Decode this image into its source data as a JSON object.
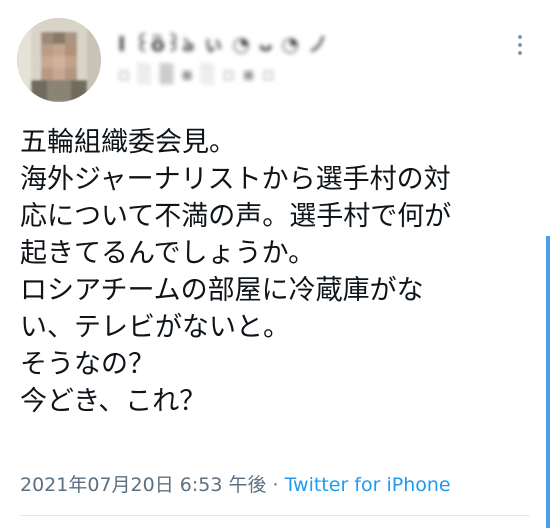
{
  "tweet": {
    "author": {
      "display_name": "I ꒰ὃ꒱ঌ ぃ ◔ ᴗ ◔ ノ",
      "handle": "▫ ░ ▒ ▪ ░ ▫ ▪ ▫",
      "avatar_icon": "blurred-avatar"
    },
    "more_icon": "more-vertical-icon",
    "text_lines": [
      "五輪組織委会見。",
      "海外ジャーナリストから選手村の対",
      "応について不満の声。選手村で何が",
      "起きてるんでしょうか。",
      "ロシアチームの部屋に冷蔵庫がな",
      "い、テレビがないと。",
      "そうなの？",
      "今どき、これ？"
    ],
    "timestamp": "2021年07月20日 6:53 午後",
    "separator": " · ",
    "source": "Twitter for iPhone"
  },
  "colors": {
    "text": "#0f1419",
    "meta": "#5b7083",
    "link": "#1d9bf0",
    "scroll_indicator": "#4a9eea"
  }
}
